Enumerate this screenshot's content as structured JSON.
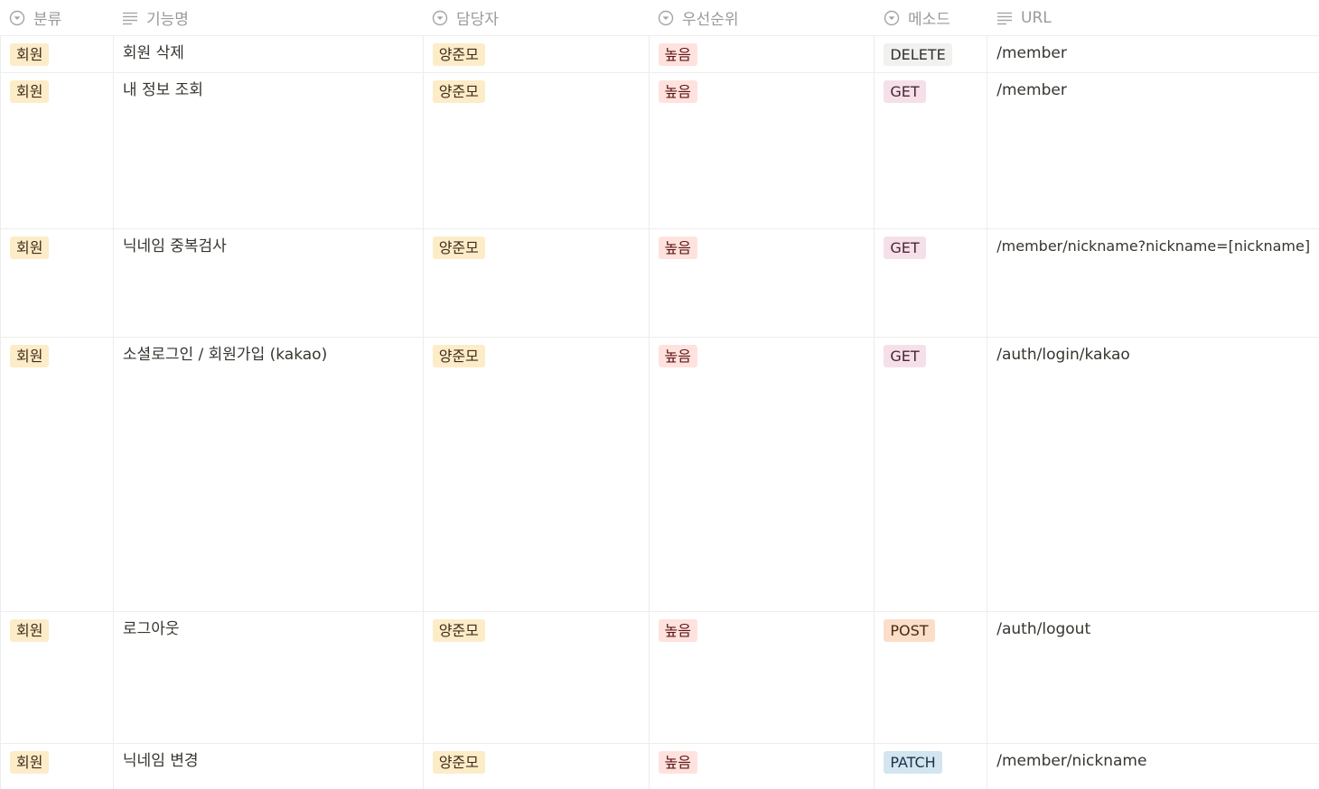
{
  "columns": [
    {
      "label": "분류",
      "icon": "select-icon"
    },
    {
      "label": "기능명",
      "icon": "text-icon"
    },
    {
      "label": "담당자",
      "icon": "select-icon"
    },
    {
      "label": "우선순위",
      "icon": "select-icon"
    },
    {
      "label": "메소드",
      "icon": "select-icon"
    },
    {
      "label": "URL",
      "icon": "text-icon"
    }
  ],
  "colors": {
    "category": "#fdecc8",
    "assignee": "#fdecc8",
    "priority": "#ffe2dd",
    "DELETE": "#f1f1ef",
    "GET": "#f5e0e9",
    "POST": "#fadec9",
    "PATCH": "#d3e5ef"
  },
  "rows": [
    {
      "category": "회원",
      "name": "회원 삭제",
      "assignee": "양준모",
      "priority": "높음",
      "method": "DELETE",
      "url": "/member"
    },
    {
      "category": "회원",
      "name": "내 정보 조회",
      "assignee": "양준모",
      "priority": "높음",
      "method": "GET",
      "url": "/member"
    },
    {
      "category": "회원",
      "name": "닉네임 중복검사",
      "assignee": "양준모",
      "priority": "높음",
      "method": "GET",
      "url": "/member/nickname?nickname=[nickname]"
    },
    {
      "category": "회원",
      "name": "소셜로그인 / 회원가입 (kakao)",
      "assignee": "양준모",
      "priority": "높음",
      "method": "GET",
      "url": "/auth/login/kakao"
    },
    {
      "category": "회원",
      "name": "로그아웃",
      "assignee": "양준모",
      "priority": "높음",
      "method": "POST",
      "url": "/auth/logout"
    },
    {
      "category": "회원",
      "name": "닉네임 변경",
      "assignee": "양준모",
      "priority": "높음",
      "method": "PATCH",
      "url": "/member/nickname"
    }
  ]
}
